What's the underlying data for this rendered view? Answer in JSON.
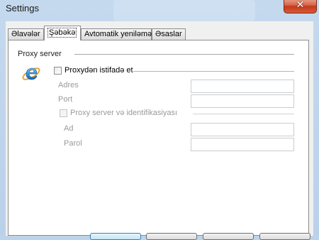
{
  "window": {
    "title": "Settings",
    "close_glyph": "✕"
  },
  "tabs": [
    {
      "label": "Əlavələr",
      "active": false
    },
    {
      "label": "Şəbəkə",
      "active": true
    },
    {
      "label": "Avtomatik yeniləmə",
      "active": false
    },
    {
      "label": "Əsaslar",
      "active": false
    }
  ],
  "proxy": {
    "section_label": "Proxy server",
    "icon": "internet-explorer-icon",
    "use_proxy_label": "Proxydən istifadə et",
    "use_proxy_checked": false,
    "address_label": "Adres",
    "address_value": "",
    "port_label": "Port",
    "port_value": "",
    "auth_label": "Proxy server və identifikasiyası",
    "auth_checked": false,
    "username_label": "Ad",
    "username_value": "",
    "password_label": "Parol",
    "password_value": ""
  },
  "colors": {
    "accent": "#1a76c6",
    "disabled_text": "#9a9a9a",
    "close_button": "#c8472a"
  }
}
